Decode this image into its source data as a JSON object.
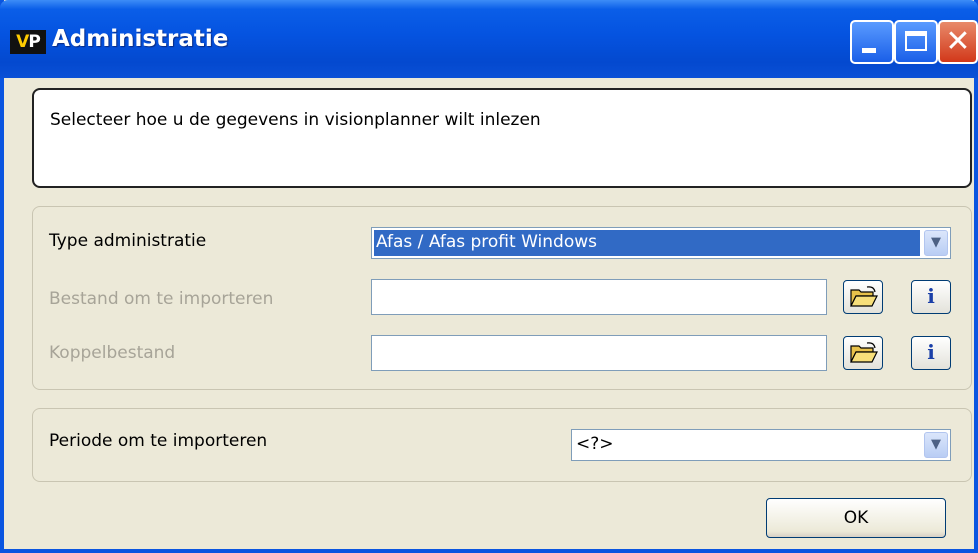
{
  "window": {
    "logo_text": "VP",
    "title": "Administratie",
    "title_bar_color": "#0553e0"
  },
  "message": "Selecteer hoe u de gegevens in visionplanner wilt inlezen",
  "import_group": {
    "type_label": "Type administratie",
    "type_value": "Afas / Afas profit Windows",
    "file_label": "Bestand om te importeren",
    "file_value": "",
    "link_label": "Koppelbestand",
    "link_value": ""
  },
  "period_group": {
    "period_label": "Periode om te importeren",
    "period_value": "<?>"
  },
  "buttons": {
    "ok": "OK",
    "info_glyph": "i"
  },
  "icons": {
    "browse": "open-folder-icon",
    "info": "info-icon",
    "dropdown": "chevron-down-icon"
  }
}
